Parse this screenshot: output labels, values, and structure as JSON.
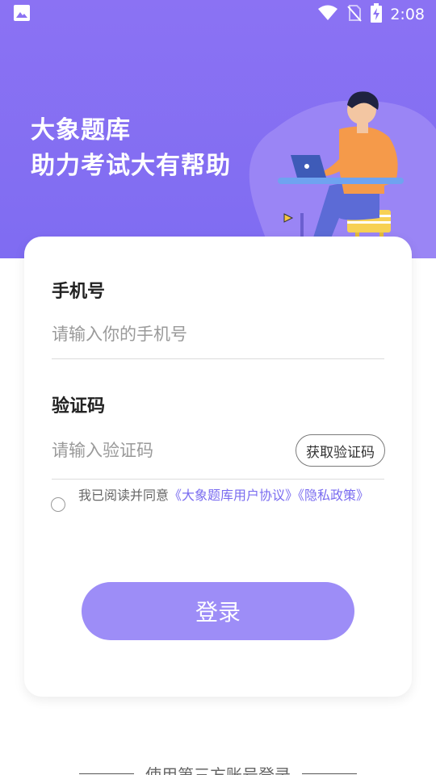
{
  "status_bar": {
    "time": "2:08",
    "icons": [
      "image-icon",
      "wifi-icon",
      "no-sim-icon",
      "battery-charging-icon"
    ]
  },
  "hero": {
    "title": "大象题库",
    "subtitle": "助力考试大有帮助",
    "background_color": "#8b72f3",
    "illustration": "person-with-laptop"
  },
  "form": {
    "phone": {
      "label": "手机号",
      "placeholder": "请输入你的手机号",
      "value": ""
    },
    "code": {
      "label": "验证码",
      "placeholder": "请输入验证码",
      "value": "",
      "get_code_label": "获取验证码"
    },
    "agreement": {
      "checked": false,
      "prefix": "我已阅读并同意",
      "user_agreement": "《大象题库用户协议》",
      "privacy_policy": "《隐私政策》",
      "link_color": "#7a6cf0"
    },
    "login_label": "登录",
    "login_color": "#9d8df7"
  },
  "footer": {
    "third_party_label": "使用第三方账号登录"
  }
}
